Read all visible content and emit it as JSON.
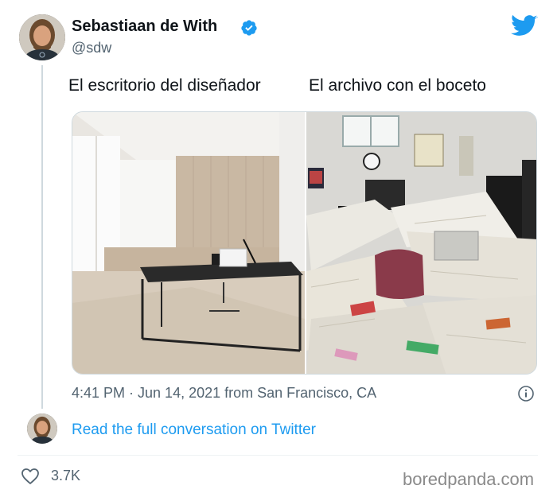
{
  "author": {
    "display_name": "Sebastiaan de With",
    "handle": "@sdw",
    "verified": true,
    "avatar_icon": "avatar"
  },
  "brand": {
    "icon": "twitter-bird-icon",
    "color": "#1d9bf0"
  },
  "tweet": {
    "caption_left": "El escritorio del diseñador",
    "caption_right": "El archivo con el boceto",
    "media": [
      {
        "name": "clean-minimal-desk-photo"
      },
      {
        "name": "cluttered-office-photo"
      }
    ],
    "timestamp": "4:41 PM · Jun 14, 2021 from San Francisco, CA"
  },
  "conversation": {
    "link_text": "Read the full conversation on Twitter"
  },
  "engagement": {
    "likes": "3.7K"
  },
  "watermark": "boredpanda.com",
  "colors": {
    "link": "#1d9bf0",
    "muted": "#536471",
    "verified": "#1d9bf0"
  }
}
